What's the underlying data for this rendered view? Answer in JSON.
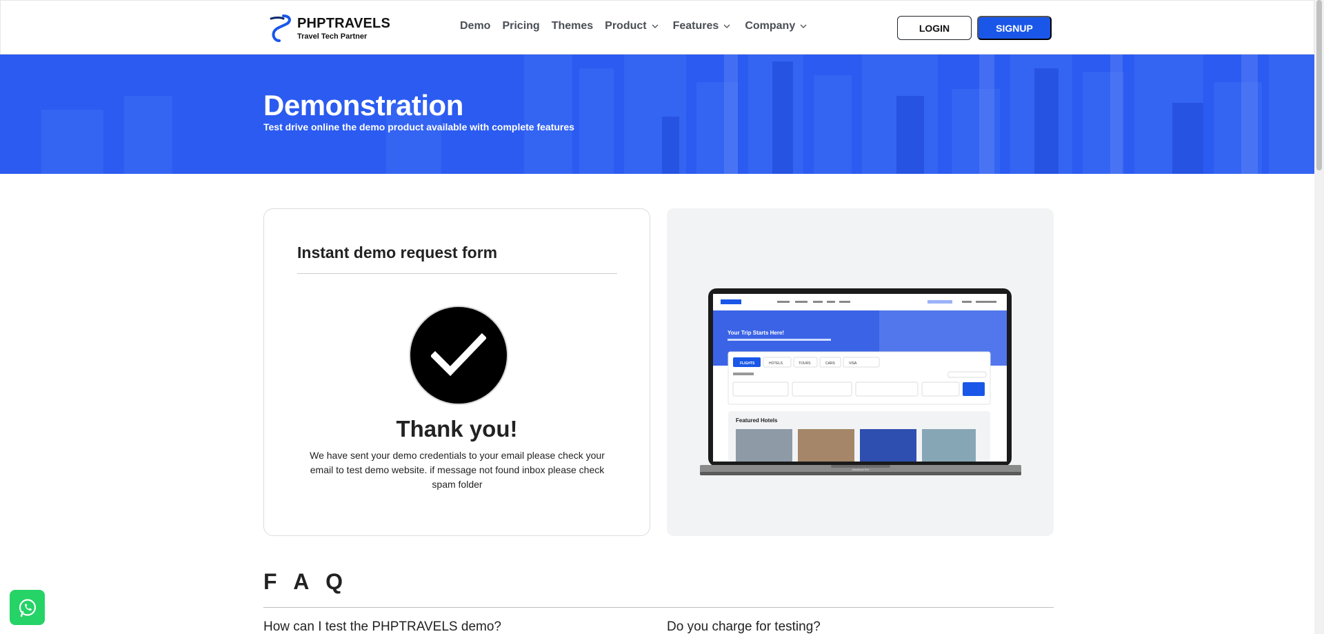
{
  "header": {
    "logo": {
      "name": "PHPTRAVELS",
      "tagline": "Travel Tech Partner"
    },
    "nav": [
      {
        "label": "Demo",
        "dropdown": false
      },
      {
        "label": "Pricing",
        "dropdown": false
      },
      {
        "label": "Themes",
        "dropdown": false
      },
      {
        "label": "Product",
        "dropdown": true
      },
      {
        "label": "Features",
        "dropdown": true
      },
      {
        "label": "Company",
        "dropdown": true
      }
    ],
    "login_label": "LOGIN",
    "signup_label": "SIGNUP"
  },
  "hero": {
    "title": "Demonstration",
    "subtitle": "Test drive online the demo product available with complete features"
  },
  "form_card": {
    "title": "Instant demo request form",
    "thanks": "Thank you!",
    "message": "We have sent your demo credentials to your email please check your email to test demo website. if message not found inbox please check spam folder"
  },
  "preview": {
    "image_alt": "PHPTRAVELS demo on laptop",
    "screen": {
      "hero_title": "Your Trip Starts Here!",
      "featured_label": "Featured Hotels",
      "tabs": [
        "FLIGHTS",
        "HOTELS",
        "TOURS",
        "CARS",
        "VISA"
      ],
      "device_label": "MacBook Pro"
    }
  },
  "faq": {
    "title": "F A Q",
    "questions": [
      "How can I test the PHPTRAVELS demo?",
      "Do you charge for testing?"
    ]
  },
  "colors": {
    "brand_blue": "#1a57e8",
    "hero_blue": "#2a5af0",
    "whatsapp_green": "#25d366"
  },
  "icons": {
    "logo": "phptravels-logo-icon",
    "check": "check-icon",
    "chevron": "chevron-down-icon",
    "whatsapp": "whatsapp-icon"
  }
}
